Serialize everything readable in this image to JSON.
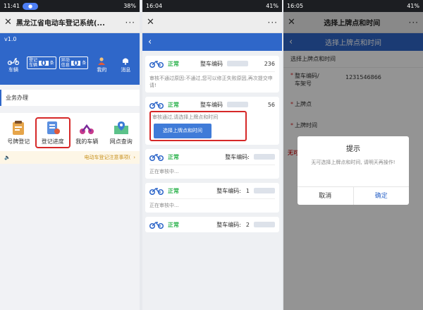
{
  "panel1": {
    "status": {
      "time": "11:41",
      "battery": "38%"
    },
    "title": "黑龙江省电动车登记系统(...",
    "more": "···",
    "version": "v1.0",
    "vehicle_label": "车辆",
    "registered_label": "登记\n车辆",
    "registered_count": "0",
    "abnormal_label": "异动\n信息",
    "abnormal_count": "0",
    "unit": "条",
    "mine_label": "我的",
    "msg_label": "消息",
    "section_title": "业务办理",
    "grid": [
      {
        "label": "号牌登记"
      },
      {
        "label": "登记进度"
      },
      {
        "label": "我的车辆"
      },
      {
        "label": "网点查询"
      }
    ],
    "notice": "电动车登记注意事项(",
    "notice_arrow": "›"
  },
  "panel2": {
    "status": {
      "time": "16:04",
      "battery": "41%"
    },
    "cards": [
      {
        "status": "正常",
        "code_label": "整车编码",
        "code_suffix": "236",
        "desc": "审核不通过原因:不通过,您可以修正失败原因,再次提交申请!"
      },
      {
        "status": "正常",
        "code_label": "整车编码",
        "code_suffix": "56",
        "hl_text": "审核通过,请选择上牌点和时间",
        "button": "选择上牌点和时间"
      },
      {
        "status": "正常",
        "code_label": "整车编码:",
        "code_suffix": "",
        "desc": "正在审核中..."
      },
      {
        "status": "正常",
        "code_label": "整车编码:",
        "code_suffix": "1",
        "desc": "正在审核中..."
      },
      {
        "status": "正常",
        "code_label": "整车编码:",
        "code_suffix": "2",
        "desc": ""
      }
    ]
  },
  "panel3": {
    "status": {
      "time": "16:05",
      "battery": "41%"
    },
    "title": "选择上牌点和时间",
    "section": "选择上牌点和时间",
    "field_code_label": "整车编码/\n车架号",
    "field_code_value": "1231546866",
    "field_point_label": "上牌点",
    "field_time_label": "上牌时间",
    "red_hint": "无可",
    "dialog": {
      "title": "提示",
      "message": "无可选择上牌点和时间, 请明天再操作!",
      "cancel": "取消",
      "ok": "确定"
    }
  },
  "colors": {
    "primary": "#2f67c9",
    "ok": "#2bb24c",
    "highlight": "#d62828"
  }
}
